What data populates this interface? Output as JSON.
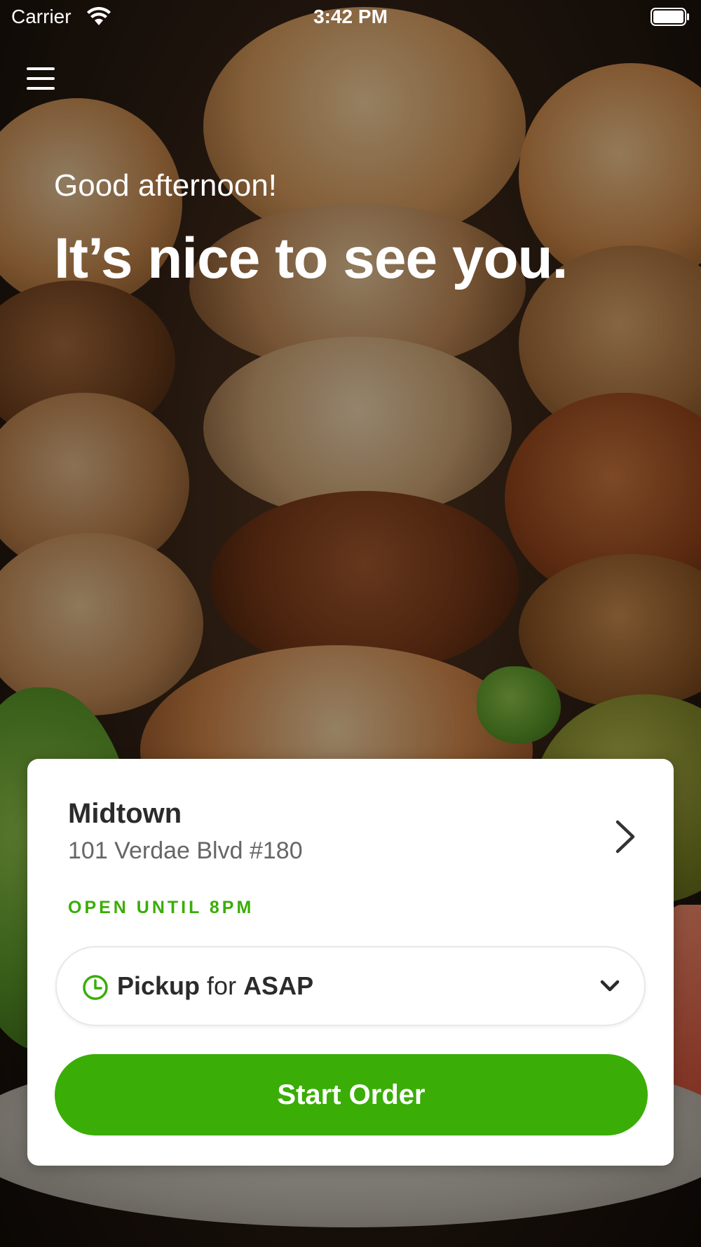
{
  "status_bar": {
    "carrier": "Carrier",
    "time": "3:42 PM"
  },
  "header": {
    "menu_icon": "hamburger-menu-icon",
    "greeting": "Good afternoon!",
    "headline": "It’s nice to see you."
  },
  "location_card": {
    "store_name": "Midtown",
    "address": "101 Verdae Blvd #180",
    "hours": "OPEN UNTIL 8PM",
    "order_mode": {
      "mode": "Pickup",
      "connector": "for",
      "time": "ASAP"
    },
    "start_button": "Start Order"
  },
  "colors": {
    "accent_green": "#3aad06",
    "text_dark": "#2b2b2b",
    "text_muted": "#666666"
  }
}
